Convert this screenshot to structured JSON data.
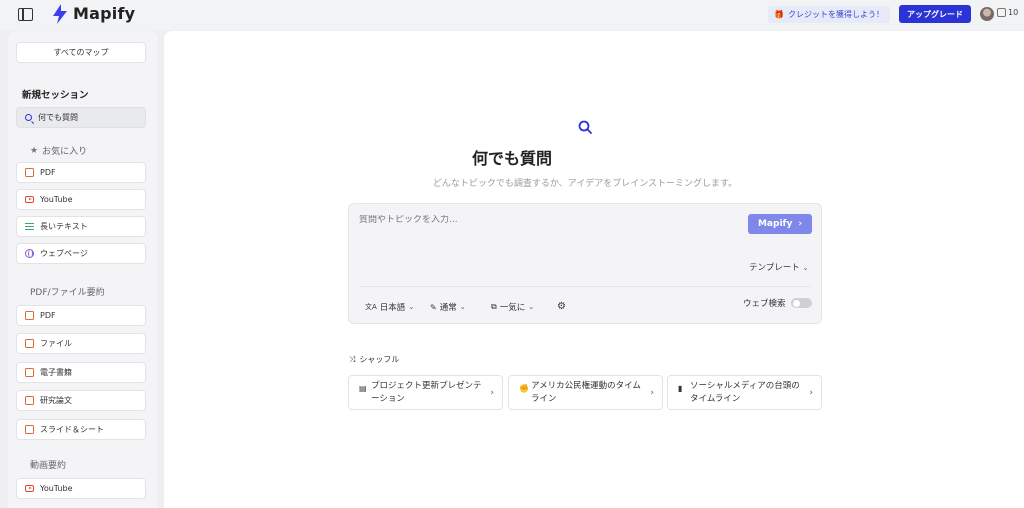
{
  "header": {
    "logo_text": "Mapify",
    "credit_button": "クレジットを獲得しよう！",
    "upgrade_button": "アップグレード",
    "credits": "10"
  },
  "sidebar": {
    "all_maps": "すべてのマップ",
    "new_session": "新規セッション",
    "ask_anything": "何でも質問",
    "favorites_label": "お気に入り",
    "favorites": [
      {
        "label": "PDF",
        "icon": "pdf-icon"
      },
      {
        "label": "YouTube",
        "icon": "youtube-icon"
      },
      {
        "label": "長いテキスト",
        "icon": "long-text-icon"
      },
      {
        "label": "ウェブページ",
        "icon": "globe-icon"
      }
    ],
    "pdf_section_label": "PDF/ファイル要約",
    "pdf_section": [
      {
        "label": "PDF",
        "icon": "pdf-icon"
      },
      {
        "label": "ファイル",
        "icon": "file-icon"
      },
      {
        "label": "電子書籍",
        "icon": "ebook-icon"
      },
      {
        "label": "研究論文",
        "icon": "paper-icon"
      },
      {
        "label": "スライド＆シート",
        "icon": "slides-icon"
      }
    ],
    "video_section_label": "動画要約",
    "video_section": [
      {
        "label": "YouTube",
        "icon": "youtube-icon"
      }
    ]
  },
  "main": {
    "title": "何でも質問",
    "subtitle": "どんなトピックでも調査するか、アイデアをブレインストーミングします。",
    "input_placeholder": "質問やトピックを入力...",
    "submit_button": "Mapify",
    "template_dropdown": "テンプレート",
    "language_option": "日本語",
    "mode_option": "通常",
    "generation_option": "一気に",
    "web_search_label": "ウェブ検索",
    "web_search_enabled": false,
    "shuffle_label": "シャッフル",
    "suggestions": [
      {
        "line1": "プロジェクト更新プレゼンテ",
        "line2": "ーション",
        "icon": "document-icon"
      },
      {
        "line1": "アメリカ公民権運動のタイム",
        "line2": "ライン",
        "icon": "fist-icon"
      },
      {
        "line1": "ソーシャルメディアの台頭の",
        "line2": "タイムライン",
        "icon": "phone-icon"
      }
    ]
  },
  "colors": {
    "accent": "#2a33d6",
    "submit_button": "#7f88ea",
    "credit_button_bg": "#e6eaf9"
  }
}
